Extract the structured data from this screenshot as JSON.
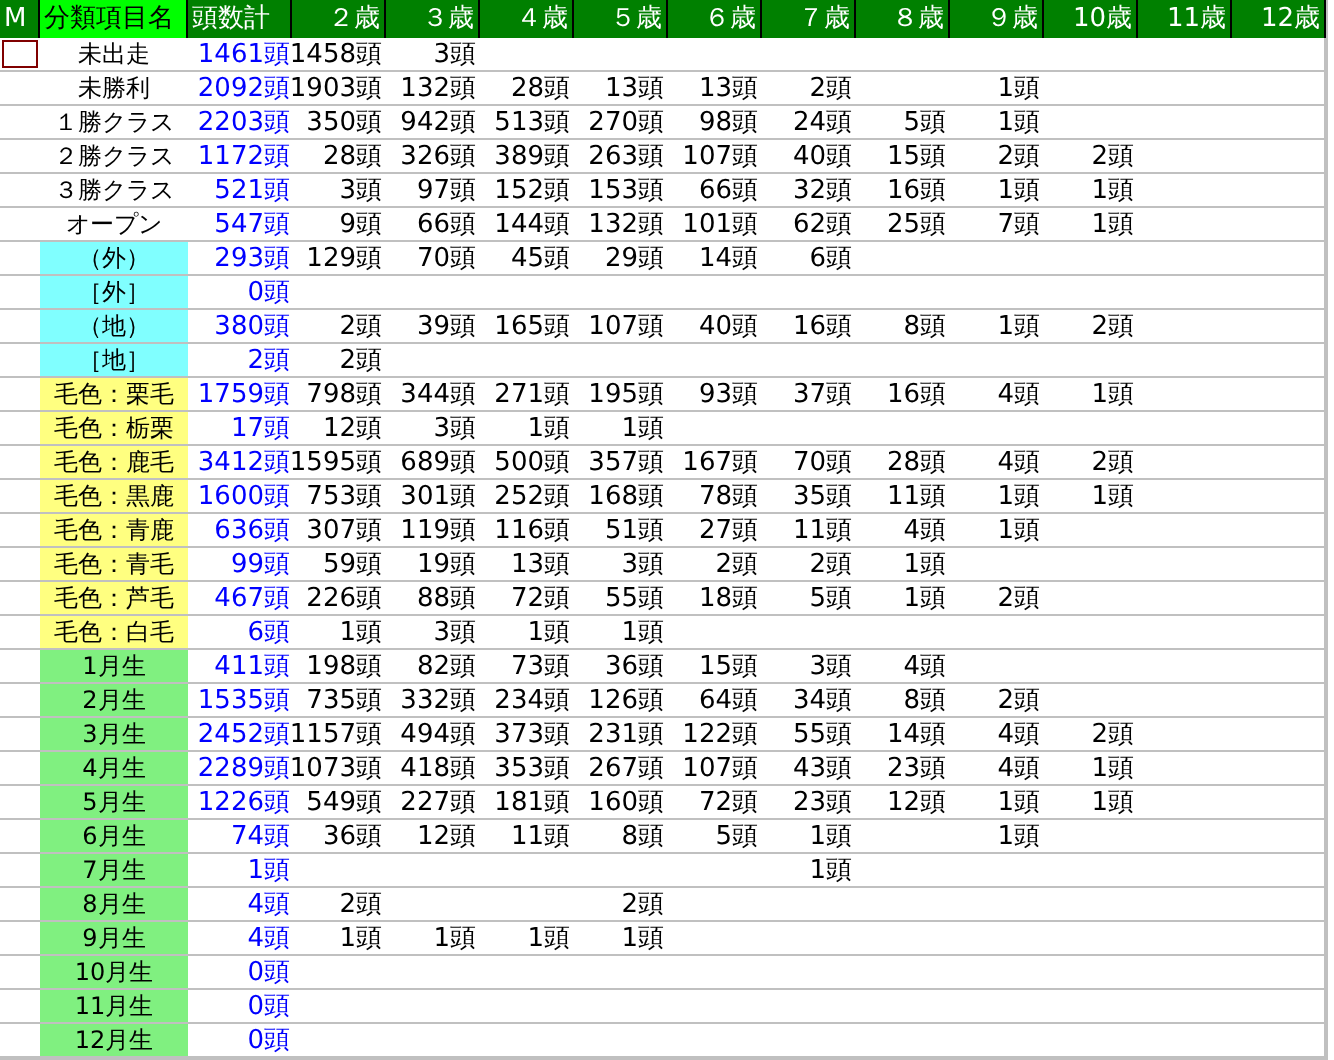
{
  "table": {
    "marker_header": "M",
    "columns": [
      {
        "label": "分類項目名",
        "selected": true
      },
      {
        "label": "頭数計",
        "selected": false
      },
      {
        "label": "２歳",
        "selected": false
      },
      {
        "label": "３歳",
        "selected": false
      },
      {
        "label": "４歳",
        "selected": false
      },
      {
        "label": "５歳",
        "selected": false
      },
      {
        "label": "６歳",
        "selected": false
      },
      {
        "label": "７歳",
        "selected": false
      },
      {
        "label": "８歳",
        "selected": false
      },
      {
        "label": "９歳",
        "selected": false
      },
      {
        "label": "10歳",
        "selected": false
      },
      {
        "label": "11歳",
        "selected": false
      },
      {
        "label": "12歳",
        "selected": false
      }
    ],
    "rows": [
      {
        "kind": "class",
        "selected": true,
        "cells": [
          "未出走",
          "1461頭",
          "1458頭",
          "3頭"
        ]
      },
      {
        "kind": "class",
        "selected": false,
        "cells": [
          "未勝利",
          "2092頭",
          "1903頭",
          "132頭",
          "28頭",
          "13頭",
          "13頭",
          "2頭",
          null,
          "1頭"
        ]
      },
      {
        "kind": "class",
        "selected": false,
        "cells": [
          "１勝クラス",
          "2203頭",
          "350頭",
          "942頭",
          "513頭",
          "270頭",
          "98頭",
          "24頭",
          "5頭",
          "1頭"
        ]
      },
      {
        "kind": "class",
        "selected": false,
        "cells": [
          "２勝クラス",
          "1172頭",
          "28頭",
          "326頭",
          "389頭",
          "263頭",
          "107頭",
          "40頭",
          "15頭",
          "2頭",
          "2頭"
        ]
      },
      {
        "kind": "class",
        "selected": false,
        "cells": [
          "３勝クラス",
          "521頭",
          "3頭",
          "97頭",
          "152頭",
          "153頭",
          "66頭",
          "32頭",
          "16頭",
          "1頭",
          "1頭"
        ]
      },
      {
        "kind": "class",
        "selected": false,
        "cells": [
          "オープン",
          "547頭",
          "9頭",
          "66頭",
          "144頭",
          "132頭",
          "101頭",
          "62頭",
          "25頭",
          "7頭",
          "1頭"
        ]
      },
      {
        "kind": "venue",
        "selected": false,
        "cells": [
          "（外）",
          "293頭",
          "129頭",
          "70頭",
          "45頭",
          "29頭",
          "14頭",
          "6頭"
        ]
      },
      {
        "kind": "venue",
        "selected": false,
        "cells": [
          "［外］",
          "0頭"
        ]
      },
      {
        "kind": "venue",
        "selected": false,
        "cells": [
          "（地）",
          "380頭",
          "2頭",
          "39頭",
          "165頭",
          "107頭",
          "40頭",
          "16頭",
          "8頭",
          "1頭",
          "2頭"
        ]
      },
      {
        "kind": "venue",
        "selected": false,
        "cells": [
          "［地］",
          "2頭",
          "2頭"
        ]
      },
      {
        "kind": "coat",
        "selected": false,
        "cells": [
          "毛色：栗毛",
          "1759頭",
          "798頭",
          "344頭",
          "271頭",
          "195頭",
          "93頭",
          "37頭",
          "16頭",
          "4頭",
          "1頭"
        ]
      },
      {
        "kind": "coat",
        "selected": false,
        "cells": [
          "毛色：栃栗",
          "17頭",
          "12頭",
          "3頭",
          "1頭",
          "1頭"
        ]
      },
      {
        "kind": "coat",
        "selected": false,
        "cells": [
          "毛色：鹿毛",
          "3412頭",
          "1595頭",
          "689頭",
          "500頭",
          "357頭",
          "167頭",
          "70頭",
          "28頭",
          "4頭",
          "2頭"
        ]
      },
      {
        "kind": "coat",
        "selected": false,
        "cells": [
          "毛色：黒鹿",
          "1600頭",
          "753頭",
          "301頭",
          "252頭",
          "168頭",
          "78頭",
          "35頭",
          "11頭",
          "1頭",
          "1頭"
        ]
      },
      {
        "kind": "coat",
        "selected": false,
        "cells": [
          "毛色：青鹿",
          "636頭",
          "307頭",
          "119頭",
          "116頭",
          "51頭",
          "27頭",
          "11頭",
          "4頭",
          "1頭"
        ]
      },
      {
        "kind": "coat",
        "selected": false,
        "cells": [
          "毛色：青毛",
          "99頭",
          "59頭",
          "19頭",
          "13頭",
          "3頭",
          "2頭",
          "2頭",
          "1頭"
        ]
      },
      {
        "kind": "coat",
        "selected": false,
        "cells": [
          "毛色：芦毛",
          "467頭",
          "226頭",
          "88頭",
          "72頭",
          "55頭",
          "18頭",
          "5頭",
          "1頭",
          "2頭"
        ]
      },
      {
        "kind": "coat",
        "selected": false,
        "cells": [
          "毛色：白毛",
          "6頭",
          "1頭",
          "3頭",
          "1頭",
          "1頭"
        ]
      },
      {
        "kind": "month",
        "selected": false,
        "cells": [
          "1月生",
          "411頭",
          "198頭",
          "82頭",
          "73頭",
          "36頭",
          "15頭",
          "3頭",
          "4頭"
        ]
      },
      {
        "kind": "month",
        "selected": false,
        "cells": [
          "2月生",
          "1535頭",
          "735頭",
          "332頭",
          "234頭",
          "126頭",
          "64頭",
          "34頭",
          "8頭",
          "2頭"
        ]
      },
      {
        "kind": "month",
        "selected": false,
        "cells": [
          "3月生",
          "2452頭",
          "1157頭",
          "494頭",
          "373頭",
          "231頭",
          "122頭",
          "55頭",
          "14頭",
          "4頭",
          "2頭"
        ]
      },
      {
        "kind": "month",
        "selected": false,
        "cells": [
          "4月生",
          "2289頭",
          "1073頭",
          "418頭",
          "353頭",
          "267頭",
          "107頭",
          "43頭",
          "23頭",
          "4頭",
          "1頭"
        ]
      },
      {
        "kind": "month",
        "selected": false,
        "cells": [
          "5月生",
          "1226頭",
          "549頭",
          "227頭",
          "181頭",
          "160頭",
          "72頭",
          "23頭",
          "12頭",
          "1頭",
          "1頭"
        ]
      },
      {
        "kind": "month",
        "selected": false,
        "cells": [
          "6月生",
          "74頭",
          "36頭",
          "12頭",
          "11頭",
          "8頭",
          "5頭",
          "1頭",
          null,
          "1頭"
        ]
      },
      {
        "kind": "month",
        "selected": false,
        "cells": [
          "7月生",
          "1頭",
          null,
          null,
          null,
          null,
          null,
          "1頭"
        ]
      },
      {
        "kind": "month",
        "selected": false,
        "cells": [
          "8月生",
          "4頭",
          "2頭",
          null,
          null,
          "2頭"
        ]
      },
      {
        "kind": "month",
        "selected": false,
        "cells": [
          "9月生",
          "4頭",
          "1頭",
          "1頭",
          "1頭",
          "1頭"
        ]
      },
      {
        "kind": "month",
        "selected": false,
        "cells": [
          "10月生",
          "0頭"
        ]
      },
      {
        "kind": "month",
        "selected": false,
        "cells": [
          "11月生",
          "0頭"
        ]
      },
      {
        "kind": "month",
        "selected": false,
        "cells": [
          "12月生",
          "0頭"
        ]
      }
    ]
  }
}
